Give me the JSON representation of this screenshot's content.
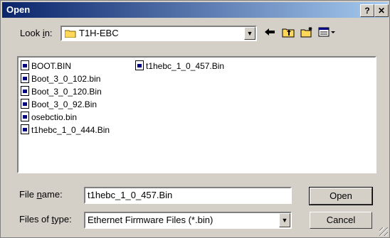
{
  "window": {
    "title": "Open",
    "help_label": "?",
    "close_label": "✕"
  },
  "look_in": {
    "label_pre": "Look ",
    "label_u": "i",
    "label_post": "n:",
    "value": "T1H-EBC"
  },
  "toolbar": {
    "back_icon": "arrow-left-icon",
    "up_icon": "up-folder-icon",
    "new_folder_icon": "new-folder-icon",
    "view_icon": "view-menu-icon"
  },
  "files": [
    "BOOT.BIN",
    "Boot_3_0_102.bin",
    "Boot_3_0_120.Bin",
    "Boot_3_0_92.Bin",
    "osebctio.bin",
    "t1hebc_1_0_444.Bin",
    "t1hebc_1_0_457.Bin"
  ],
  "file_name": {
    "label_pre": "File ",
    "label_u": "n",
    "label_post": "ame:",
    "value": "t1hebc_1_0_457.Bin"
  },
  "file_type": {
    "label_pre": "Files of ",
    "label_u": "t",
    "label_post": "ype:",
    "value": "Ethernet Firmware Files (*.bin)"
  },
  "buttons": {
    "open": "Open",
    "cancel": "Cancel"
  }
}
